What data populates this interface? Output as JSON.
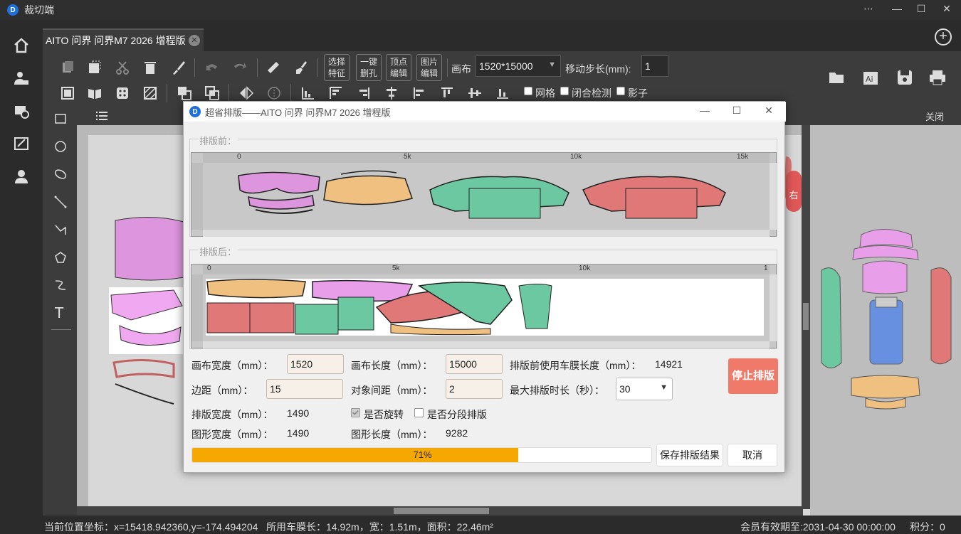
{
  "app": {
    "title": "裁切端",
    "logo_letter": "D"
  },
  "tab": {
    "label": "AITO 问界 问界M7 2026 增程版"
  },
  "toolbar": {
    "buttons": [
      {
        "label": "选择\n特征",
        "line1": "选择",
        "line2": "特征"
      },
      {
        "line1": "一键",
        "line2": "删孔"
      },
      {
        "line1": "顶点",
        "line2": "编辑"
      },
      {
        "line1": "图片",
        "line2": "编辑"
      }
    ],
    "canvas_label": "画布",
    "canvas_value": "1520*15000",
    "step_label": "移动步长(mm):",
    "step_value": "1",
    "grid_label": "网格",
    "closure_label": "闭合检测",
    "shadow_label": "影子"
  },
  "right_panel": {
    "close_label": "关闭",
    "side_badge": "右"
  },
  "status": {
    "position": "当前位置坐标：x=15418.942360,y=-174.494204",
    "film_usage": "所用车膜长：14.92m，宽：1.51m，面积：22.46m²",
    "membership": "会员有效期至:2031-04-30 00:00:00",
    "points": "积分：0"
  },
  "dialog": {
    "title": "超省排版——AITO 问界 问界M7 2026 增程版",
    "before_label": "排版前：",
    "after_label": "排版后：",
    "ruler_before": [
      "0",
      "5k",
      "10k",
      "15k"
    ],
    "ruler_after": [
      "0",
      "5k",
      "10k",
      "1"
    ],
    "fields": {
      "canvas_width_label": "画布宽度（mm）：",
      "canvas_width": "1520",
      "canvas_length_label": "画布长度（mm）：",
      "canvas_length": "15000",
      "film_before_label": "排版前使用车膜长度（mm）：",
      "film_before": "14921",
      "margin_label": "边距（mm）：",
      "margin": "15",
      "spacing_label": "对象间距（mm）：",
      "spacing": "2",
      "max_time_label": "最大排版时长（秒）：",
      "max_time": "30",
      "layout_width_label": "排版宽度（mm）：",
      "layout_width": "1490",
      "rotate_label": "是否旋转",
      "segment_label": "是否分段排版",
      "shape_width_label": "图形宽度（mm）：",
      "shape_width": "1490",
      "shape_length_label": "图形长度（mm）：",
      "shape_length": "9282"
    },
    "rotate_checked": true,
    "segment_checked": false,
    "stop_label": "停止排版",
    "progress_value": 0.71,
    "progress_text": "71%",
    "save_label": "保存排版结果",
    "cancel_label": "取消"
  },
  "colors": {
    "pink": "#e89ee8",
    "orange": "#f0c080",
    "green": "#6cc8a0",
    "red": "#e07878",
    "blue": "#6890e0",
    "progress": "#f5a800",
    "stop": "#f07a6a"
  }
}
